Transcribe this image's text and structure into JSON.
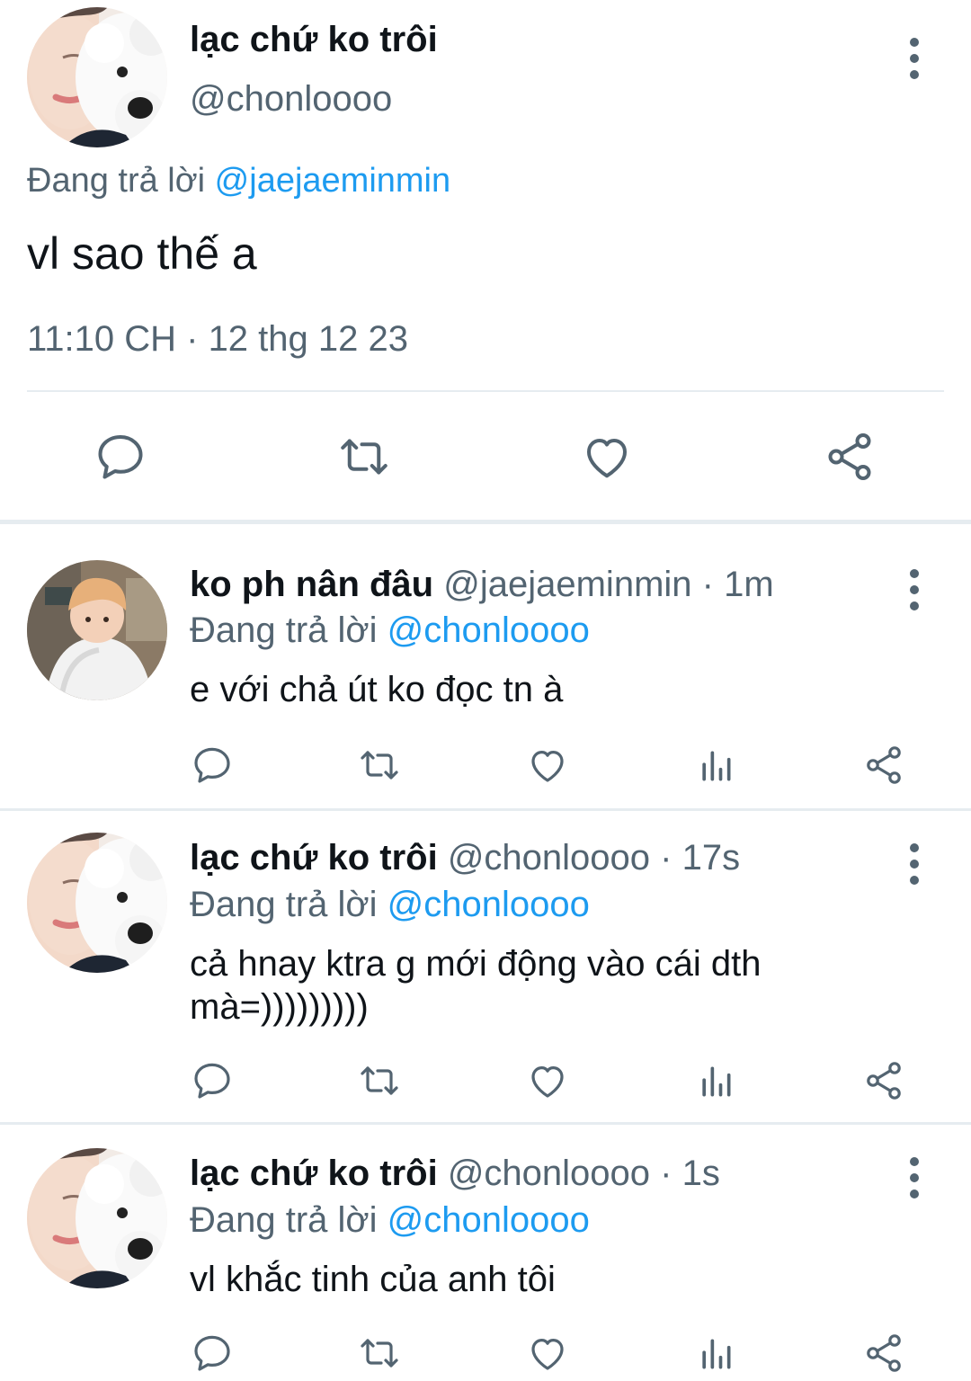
{
  "main_tweet": {
    "author_name": "lạc chứ ko trôi",
    "author_handle": "@chonloooo",
    "replying_prefix": "Đang trả lời",
    "replying_to": "@jaejaeminmin",
    "text": "vl sao thế a",
    "timestamp": "11:10 CH · 12 thg 12 23",
    "actions": [
      "reply-icon",
      "retweet-icon",
      "like-icon",
      "share-icon"
    ]
  },
  "replies": [
    {
      "author_name": "ko ph nân đâu",
      "author_handle": "@jaejaeminmin",
      "time": "· 1m",
      "replying_prefix": "Đang trả lời",
      "replying_to": "@chonloooo",
      "text_line1": "e với chả út ko đọc tn à",
      "text_line2": ""
    },
    {
      "author_name": "lạc chứ ko trôi",
      "author_handle": "@chonloooo",
      "time": "· 17s",
      "replying_prefix": "Đang trả lời",
      "replying_to": "@chonloooo",
      "text_line1": "cả hnay ktra g mới động vào cái dth",
      "text_line2": "mà=)))))))))"
    },
    {
      "author_name": "lạc chứ ko trôi",
      "author_handle": "@chonloooo",
      "time": "· 1s",
      "replying_prefix": "Đang trả lời",
      "replying_to": "@chonloooo",
      "text_line1": "vl khắc tinh của anh tôi",
      "text_line2": ""
    }
  ],
  "colors": {
    "link": "#1d9bf0",
    "secondary": "#536471",
    "text": "#0f1419",
    "divider": "#e6ecf0"
  }
}
